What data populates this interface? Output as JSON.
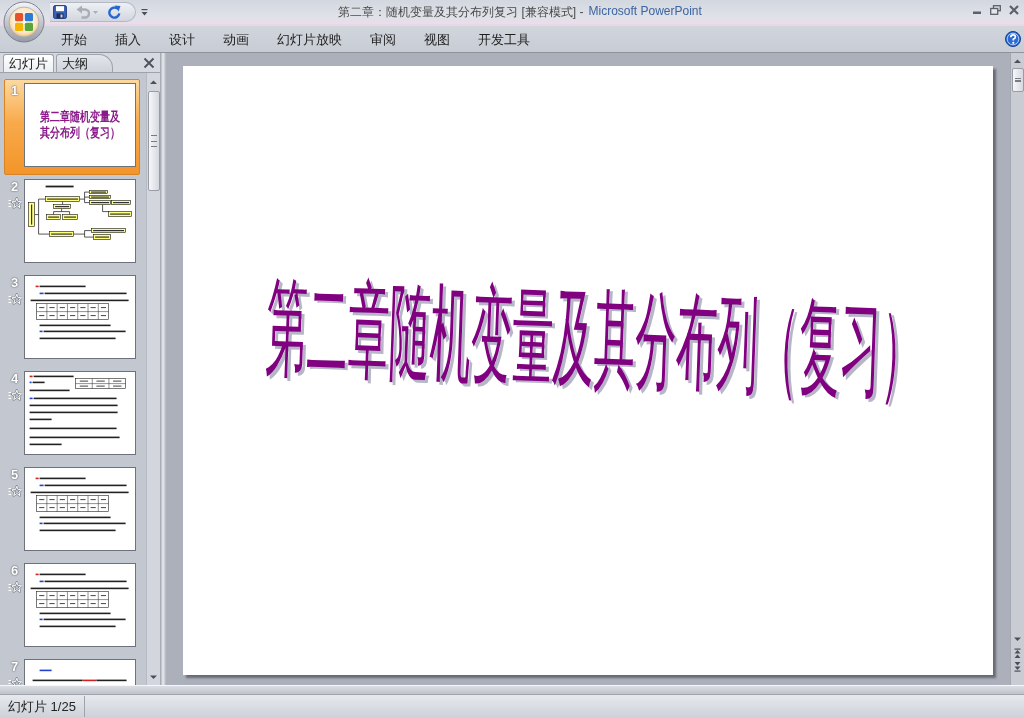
{
  "window": {
    "document": "第二章：随机变量及其分布列复习 [兼容模式] -",
    "application": "Microsoft PowerPoint"
  },
  "quick_access": [
    {
      "disabled": false
    },
    {
      "disabled": true
    },
    {
      "disabled": false
    }
  ],
  "ribbon": {
    "tabs": [
      {
        "label": "开始",
        "selected": false
      },
      {
        "label": "插入",
        "selected": false
      },
      {
        "label": "设计",
        "selected": false
      },
      {
        "label": "动画",
        "selected": false
      },
      {
        "label": "幻灯片放映",
        "selected": false
      },
      {
        "label": "审阅",
        "selected": false
      },
      {
        "label": "视图",
        "selected": false
      },
      {
        "label": "开发工具",
        "selected": false
      }
    ]
  },
  "slides_pane": {
    "tabs": [
      {
        "label": "幻灯片",
        "selected": true
      },
      {
        "label": "大纲",
        "selected": false
      }
    ],
    "slides": [
      {
        "number": "1",
        "selected": true,
        "animated": false,
        "kind": "title",
        "title": "第二章随机变量及其分布列（复习）"
      },
      {
        "number": "2",
        "selected": false,
        "animated": true,
        "kind": "flowchart"
      },
      {
        "number": "3",
        "selected": false,
        "animated": true,
        "kind": "text-table"
      },
      {
        "number": "4",
        "selected": false,
        "animated": true,
        "kind": "side-table"
      },
      {
        "number": "5",
        "selected": false,
        "animated": true,
        "kind": "text-table"
      },
      {
        "number": "6",
        "selected": false,
        "animated": true,
        "kind": "text-table"
      },
      {
        "number": "7",
        "selected": false,
        "animated": true,
        "kind": "text"
      }
    ]
  },
  "slide": {
    "title": "第二章随机变量及其分布列（复习）"
  },
  "status_bar": {
    "slide_indicator": "幻灯片 1/25"
  }
}
